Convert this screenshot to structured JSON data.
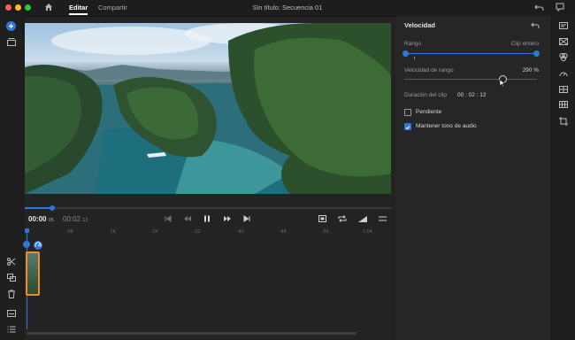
{
  "window": {
    "title": "Sin título: Secuencia 01",
    "traffic_colors": [
      "#ff5f57",
      "#febc2e",
      "#28c840"
    ]
  },
  "tabs": [
    {
      "label": "Editar",
      "active": true
    },
    {
      "label": "Compartir",
      "active": false
    }
  ],
  "accent": "#2d78d8",
  "clip_highlight": "#f08a24",
  "speed_panel": {
    "title": "Velocidad",
    "rango_label": "Rango",
    "rango_value": "Clip entero",
    "velocidad_label": "Velocidad de rango",
    "velocidad_value": "290 %",
    "velocidad_fraction": 0.73,
    "duracion_label": "Duración del clip",
    "duracion_value": "00 : 02 : 12",
    "pendiente_label": "Pendiente",
    "pendiente_checked": false,
    "mantener_label": "Mantener tono de audio",
    "mantener_checked": true
  },
  "transport": {
    "current_time": "00:00",
    "current_frames": "05",
    "total_time": "00:02",
    "total_frames": "12",
    "playhead_fraction": 0.075
  },
  "ruler": {
    "labels": [
      ":08",
      ":16",
      ":24",
      ":32",
      ":40",
      ":48",
      ":56",
      "1:04"
    ]
  },
  "icons": {
    "left_toolbar": [
      "add-icon",
      "library-icon",
      "scissors-icon",
      "duplicate-icon",
      "trash-icon",
      "captions-icon",
      "list-icon"
    ],
    "right_toolbar": [
      "comment-icon",
      "title-icon",
      "transition-icon",
      "color-icon",
      "speed-icon",
      "layout-icon",
      "crop-icon"
    ]
  }
}
